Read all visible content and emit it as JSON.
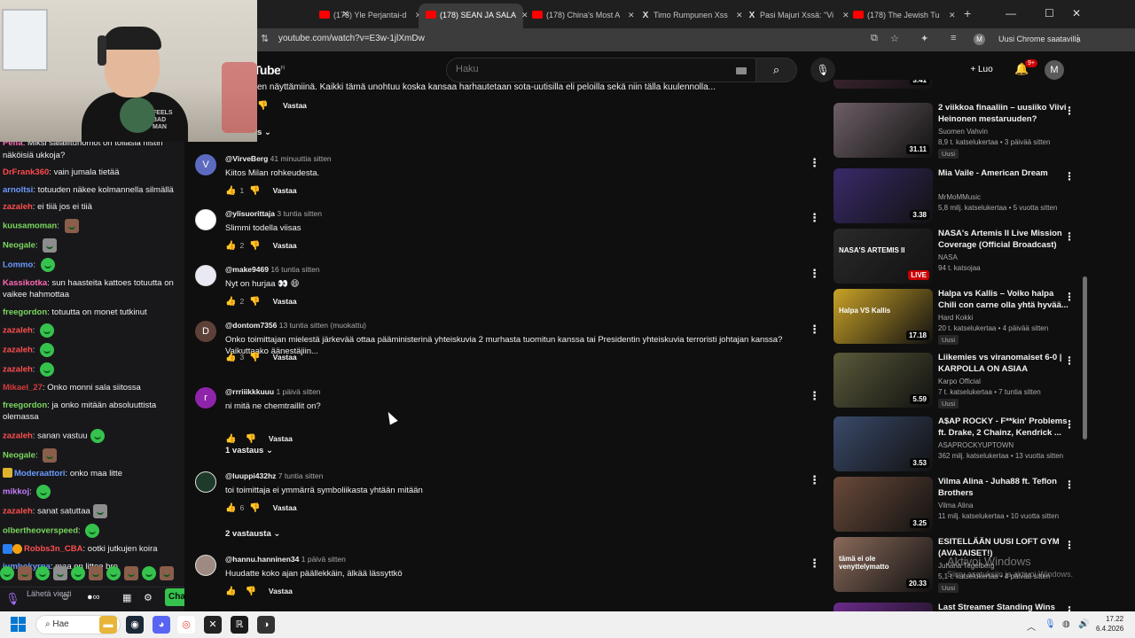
{
  "webcam": {
    "shirt_text": "FEELS\nBAD\nMAN"
  },
  "chat": {
    "messages": [
      {
        "user": "Pelfa",
        "color": "#ff69b4",
        "text": "Miksi salailitunomot on tollasia nistin näköisiä ukkoja?"
      },
      {
        "user": "DrFrank360",
        "color": "#ff4a4a",
        "text": "vain jumala tietää"
      },
      {
        "user": "arnoltsi",
        "color": "#6c9bff",
        "text": "totuuden näkee kolmannella silmällä"
      },
      {
        "user": "zazaleh",
        "color": "#ff4f4f",
        "text": "ei tiiä jos ei tiiä"
      },
      {
        "user": "kuusamoman",
        "color": "#7bd85e",
        "text": "",
        "emote": "face"
      },
      {
        "user": "Neogale",
        "color": "#7bd85e",
        "text": "",
        "emote": "grey"
      },
      {
        "user": "Lommo",
        "color": "#6c9bff",
        "text": "",
        "emote": "green"
      },
      {
        "user": "Kassikotka",
        "color": "#ff69b4",
        "text": "sun haasteita kattoes totuutta on vaikee hahmottaa"
      },
      {
        "user": "freegordon",
        "color": "#7bd85e",
        "text": "totuutta on monet tutkinut"
      },
      {
        "user": "zazaleh",
        "color": "#ff4f4f",
        "text": "",
        "emote": "green"
      },
      {
        "user": "zazaleh",
        "color": "#ff4f4f",
        "text": "",
        "emote": "green"
      },
      {
        "user": "zazaleh",
        "color": "#ff4f4f",
        "text": "",
        "emote": "green"
      },
      {
        "user": "Mikael_27",
        "color": "#d63b3b",
        "text": "Onko monni sala siitossa"
      },
      {
        "user": "freegordon",
        "color": "#7bd85e",
        "text": "ja onko mitään absoluuttista olemassa"
      },
      {
        "user": "zazaleh",
        "color": "#ff4f4f",
        "text": "sanan vastuu",
        "emote": "green"
      },
      {
        "user": "Neogale",
        "color": "#7bd85e",
        "text": "",
        "emote": "face"
      },
      {
        "user": "Moderaattori",
        "color": "#6c9bff",
        "text": "onko maa litte",
        "badge": "mod"
      },
      {
        "user": "mikkoj",
        "color": "#c77dff",
        "text": "",
        "emote": "green"
      },
      {
        "user": "zazaleh",
        "color": "#ff4f4f",
        "text": "sanat satuttaa",
        "emote": "grey"
      },
      {
        "user": "olbertheoverspeed",
        "color": "#7bd85e",
        "text": "",
        "emote": "green"
      },
      {
        "user": "Robbs3n_CBA",
        "color": "#ff4f4f",
        "text": "ootki jutkujen koira",
        "badge": "blue"
      },
      {
        "user": "jumbokyrpa",
        "color": "#6c9bff",
        "text": "maa on littee bro"
      }
    ],
    "send_placeholder": "Lähetä viesti",
    "chat_button": "Chat"
  },
  "tabs": [
    {
      "label": "(178) Yle Perjantai-d",
      "icon": "youtube"
    },
    {
      "label": "(178) SEAN JA SALA",
      "icon": "youtube",
      "active": true
    },
    {
      "label": "(178) China's Most A",
      "icon": "youtube"
    },
    {
      "label": "Timo Rumpunen Xss",
      "icon": "x"
    },
    {
      "label": "Pasi Majuri Xssä: \"Vi",
      "icon": "x"
    },
    {
      "label": "(178) The Jewish Tu",
      "icon": "youtube"
    }
  ],
  "address": {
    "url": "youtube.com/watch?v=E3w-1jlXmDw",
    "profile_initial": "M",
    "update_label": "Uusi Chrome saatavilla"
  },
  "yt_header": {
    "logo": "YouTube",
    "region": "FI",
    "search_placeholder": "Haku",
    "create_label": "Luo",
    "notif_count": "9+",
    "avatar_initial": "M"
  },
  "comments": {
    "top_line": "en näyttämiinä. Kaikki tämä unohtuu koska kansaa harhautetaan sota-uutisilla eli peloilla sekä niin tälla kuulennolla...",
    "reply_label": "Vastaa",
    "list": [
      {
        "author": "@VirveBerg",
        "time": "41 minuuttia sitten",
        "text": "Kiitos Milan rohkeudesta.",
        "likes": "1",
        "avatar": "V",
        "avatar_color": "#5c6bc0"
      },
      {
        "author": "@ylisuorittaja",
        "time": "3 tuntia sitten",
        "text": "Slimmi todella viisas",
        "likes": "2",
        "avatar": "",
        "avatar_color": "#ffffff"
      },
      {
        "author": "@make9469",
        "time": "16 tuntia sitten",
        "text": "Nyt on hurjaa 👀 😄",
        "likes": "2",
        "avatar": "",
        "avatar_color": "#e9e9f3"
      },
      {
        "author": "@dontom7356",
        "time": "13 tuntia sitten (muokattu)",
        "text": "Onko toimittajan mielestä järkevää ottaa pääministerinä yhteiskuvia 2 murhasta tuomitun kanssa tai Presidentin yhteiskuvia terroristi johtajan kanssa? Vaikuttaako äänestäjiin...",
        "likes": "3",
        "avatar": "D",
        "avatar_color": "#5d4037"
      },
      {
        "author": "@rrriiikkkuuu",
        "time": "1 päivä sitten",
        "text": "ni mitä ne chemtraillit on?",
        "likes": "",
        "avatar": "r",
        "avatar_color": "#8e24aa"
      },
      {
        "author": "@luuppi432hz",
        "time": "7 tuntia sitten",
        "text": "toi toimittaja ei ymmärrä symboliikasta yhtään mitään",
        "likes": "6",
        "avatar": "",
        "avatar_color": "#1d3a2a"
      },
      {
        "author": "@hannu.hanninen34",
        "time": "1 päivä sitten",
        "text": "Huudatte koko ajan päällekkäin, älkää lässyttkö",
        "likes": "",
        "avatar": "",
        "avatar_color": "#9e8a80"
      }
    ],
    "replies_1": "1 vastaus",
    "replies_2": "2 vastausta"
  },
  "related": [
    {
      "title": "",
      "channel": "",
      "stats": "",
      "duration": "3.41",
      "thumb": "#4a2a3a"
    },
    {
      "title": "2 viikkoa finaaliin – uusiiko Viivi Heinonen mestaruuden?",
      "channel": "Suomen Vahvin",
      "stats": "8,9 t. katselukertaa • 3 päivää sitten",
      "duration": "31.11",
      "new": "Uusi",
      "thumb": "#6d5f66"
    },
    {
      "title": "Mia Vaile - American Dream",
      "channel": "MrMoMMusic",
      "stats": "5,8 milj. katselukertaa • 5 vuotta sitten",
      "duration": "3.38",
      "thumb": "#3a2a6a"
    },
    {
      "title": "NASA's Artemis II Live Mission Coverage (Official Broadcast)",
      "channel": "NASA",
      "stats": "94 t. katsojaa",
      "duration": "LIVE",
      "thumb": "#2a2a2a",
      "thumb_text": "NASA'S ARTEMIS II"
    },
    {
      "title": "Halpa vs Kallis – Voiko halpa Chili con carne olla yhtä hyvää...",
      "channel": "Hard Kokki",
      "stats": "20 t. katselukertaa • 4 päivää sitten",
      "duration": "17.18",
      "new": "Uusi",
      "thumb": "#c9a227",
      "thumb_text": "Halpa VS Kallis"
    },
    {
      "title": "Liikemies vs viranomaiset 6-0 | KARPOLLA ON ASIAA",
      "channel": "Karpo Official",
      "stats": "7 t. katselukertaa • 7 tuntia sitten",
      "duration": "5.59",
      "new": "Uusi",
      "thumb": "#5a5a3a"
    },
    {
      "title": "A$AP ROCKY - F**kin' Problems ft. Drake, 2 Chainz, Kendrick ...",
      "channel": "ASAPROCKYUPTOWN",
      "stats": "362 milj. katselukertaa • 13 vuotta sitten",
      "duration": "3.53",
      "thumb": "#3a4a6a"
    },
    {
      "title": "Vilma Alina - Juha88 ft. Teflon Brothers",
      "channel": "Vilma Alina",
      "stats": "11 milj. katselukertaa • 10 vuotta sitten",
      "duration": "3.25",
      "thumb": "#6a4a3a"
    },
    {
      "title": "ESITELLÄÄN UUSI LOFT GYM (AVAJAISET!)",
      "channel": "Juhana Tegelberg",
      "stats": "5,1 t. katselukertaa • 4 päivää sitten",
      "duration": "20.33",
      "new": "Uusi",
      "thumb": "#8a6a5a",
      "thumb_text": "tämä ei ole venyttelymatto"
    },
    {
      "title": "Last Streamer Standing Wins",
      "channel": "",
      "stats": "",
      "duration": "LIVE",
      "thumb": "#6a2a8a"
    }
  ],
  "watermark": {
    "line1": "Aktivoi Windows",
    "line2": "Siirry asetuksiin ja aktivoi Windows."
  },
  "taskbar": {
    "search_label": "Hae",
    "time": "17.22",
    "date": "6.4.2026"
  }
}
